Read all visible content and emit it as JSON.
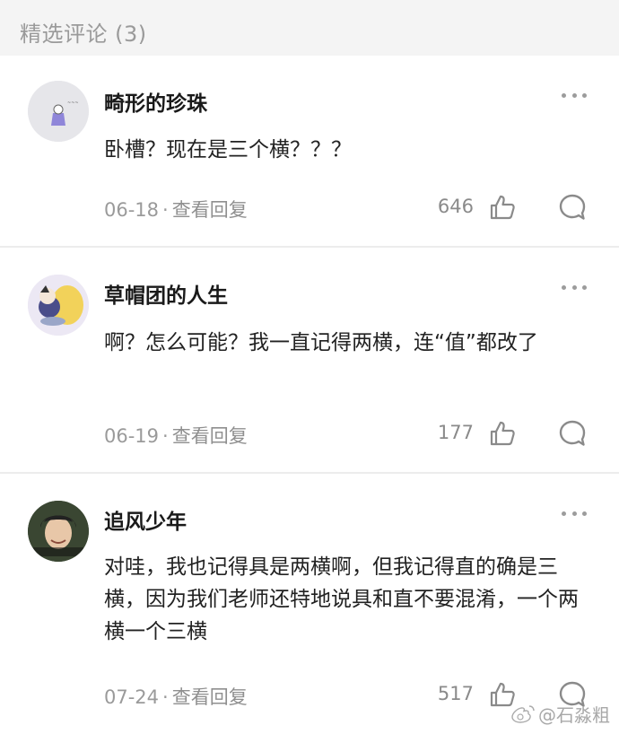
{
  "section": {
    "title": "精选评论 (3)"
  },
  "comments": [
    {
      "username": "畸形的珍珠",
      "text": "卧槽？现在是三个横？？？",
      "date": "06-18",
      "separator": "·",
      "reply_link": "查看回复",
      "likes": "646"
    },
    {
      "username": "草帽团的人生",
      "text": "啊？怎么可能？我一直记得两横，连“值”都改了",
      "date": "06-19",
      "separator": "·",
      "reply_link": "查看回复",
      "likes": "177"
    },
    {
      "username": "追风少年",
      "text": "对哇，我也记得具是两横啊，但我记得直的确是三横，因为我们老师还特地说具和直不要混淆，一个两横一个三横",
      "date": "07-24",
      "separator": "·",
      "reply_link": "查看回复",
      "likes": "517"
    }
  ],
  "watermark": {
    "text": "@石淼粗"
  },
  "icons": {
    "more": "more-dots-icon",
    "like": "thumbs-up-icon",
    "reply": "comment-bubble-icon",
    "weibo": "weibo-logo-icon"
  }
}
